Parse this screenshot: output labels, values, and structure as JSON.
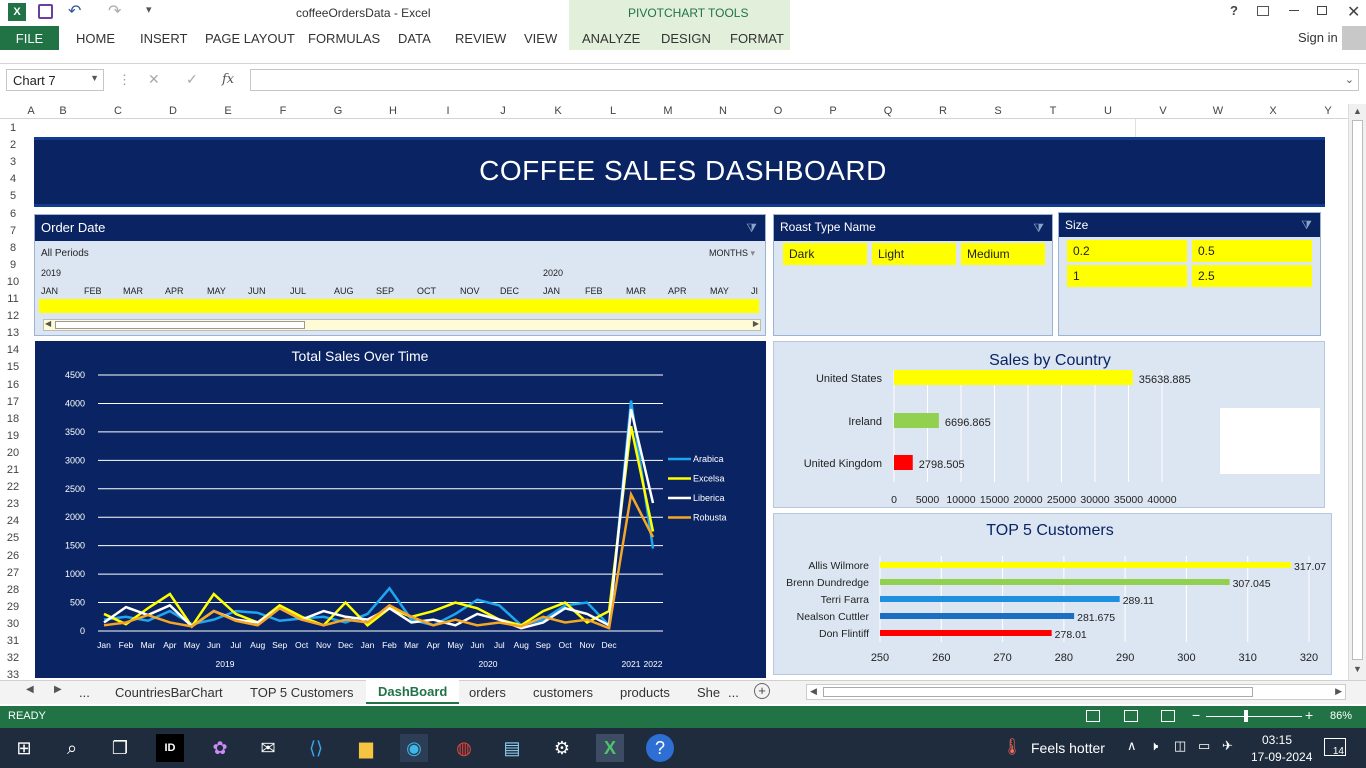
{
  "window": {
    "title": "coffeeOrdersData - Excel",
    "pivot_tools": "PIVOTCHART TOOLS",
    "help": "?",
    "signin": "Sign in"
  },
  "ribbon": {
    "file": "FILE",
    "tabs": [
      "HOME",
      "INSERT",
      "PAGE LAYOUT",
      "FORMULAS",
      "DATA",
      "REVIEW",
      "VIEW"
    ],
    "pivot_tabs": [
      "ANALYZE",
      "DESIGN",
      "FORMAT"
    ]
  },
  "formula_bar": {
    "name_box": "Chart 7",
    "fx": "fx",
    "value": ""
  },
  "columns": [
    "A",
    "B",
    "C",
    "D",
    "E",
    "F",
    "G",
    "H",
    "I",
    "J",
    "K",
    "L",
    "M",
    "N",
    "O",
    "P",
    "Q",
    "R",
    "S",
    "T",
    "U",
    "V",
    "W",
    "X",
    "Y"
  ],
  "rows": [
    "1",
    "2",
    "3",
    "4",
    "5",
    "6",
    "7",
    "8",
    "9",
    "10",
    "11",
    "12",
    "13",
    "14",
    "15",
    "16",
    "17",
    "18",
    "19",
    "20",
    "21",
    "22",
    "23",
    "24",
    "25",
    "26",
    "27",
    "28",
    "29",
    "30",
    "31",
    "32",
    "33"
  ],
  "dashboard": {
    "title": "COFFEE SALES DASHBOARD"
  },
  "timeline": {
    "title": "Order Date",
    "period": "All Periods",
    "unit": "MONTHS",
    "years": [
      "2019",
      "2020"
    ],
    "months": [
      "JAN",
      "FEB",
      "MAR",
      "APR",
      "MAY",
      "JUN",
      "JUL",
      "AUG",
      "SEP",
      "OCT",
      "NOV",
      "DEC",
      "JAN",
      "FEB",
      "MAR",
      "APR",
      "MAY",
      "JI"
    ]
  },
  "roast_slicer": {
    "title": "Roast Type Name",
    "items": [
      "Dark",
      "Light",
      "Medium"
    ]
  },
  "size_slicer": {
    "title": "Size",
    "items": [
      "0.2",
      "0.5",
      "1",
      "2.5"
    ]
  },
  "line_chart": {
    "title": "Total Sales Over Time",
    "y_ticks": [
      "4500",
      "4000",
      "3500",
      "3000",
      "2500",
      "2000",
      "1500",
      "1000",
      "500",
      "0"
    ],
    "months": [
      "Jan",
      "Feb",
      "Mar",
      "Apr",
      "May",
      "Jun",
      "Jul",
      "Aug",
      "Sep",
      "Oct",
      "Nov",
      "Dec",
      "Jan",
      "Feb",
      "Mar",
      "Apr",
      "May",
      "Jun",
      "Jul",
      "Aug",
      "Sep",
      "Oct",
      "Nov",
      "Dec"
    ],
    "years": [
      "2019",
      "2020",
      "2021",
      "2022"
    ],
    "legend": [
      "Arabica",
      "Excelsa",
      "Liberica",
      "Robusta"
    ],
    "colors": [
      "#1ea7f0",
      "#ffff00",
      "#ffffff",
      "#f5a623"
    ]
  },
  "country_chart": {
    "title": "Sales by Country",
    "countries": [
      "United States",
      "Ireland",
      "United Kingdom"
    ],
    "values": [
      "35638.885",
      "6696.865",
      "2798.505"
    ],
    "colors": [
      "#ffff00",
      "#92d050",
      "#ff0000"
    ],
    "x_ticks": [
      "0",
      "5000",
      "10000",
      "15000",
      "20000",
      "25000",
      "30000",
      "35000",
      "40000"
    ],
    "legend": [
      "United Kingdom",
      "Ireland",
      "United States"
    ]
  },
  "customers_chart": {
    "title": "TOP 5 Customers",
    "names": [
      "Allis Wilmore",
      "Brenn Dundredge",
      "Terri Farra",
      "Nealson Cuttler",
      "Don Flintiff"
    ],
    "values": [
      "317.07",
      "307.045",
      "289.11",
      "281.675",
      "278.01"
    ],
    "colors": [
      "#ffff00",
      "#92d050",
      "#1f8fe0",
      "#1a6fc0",
      "#ff0000"
    ],
    "x_ticks": [
      "250",
      "260",
      "270",
      "280",
      "290",
      "300",
      "310",
      "320"
    ]
  },
  "sheet_tabs": {
    "ellipsis": "...",
    "tabs": [
      "CountriesBarChart",
      "TOP 5 Customers",
      "DashBoard",
      "orders",
      "customers",
      "products",
      "She"
    ],
    "more": "..."
  },
  "status": {
    "ready": "READY",
    "zoom": "86%"
  },
  "taskbar": {
    "weather": "Feels hotter",
    "time": "03:15",
    "date": "17-09-2024",
    "notif": "14"
  },
  "chart_data": [
    {
      "type": "line",
      "title": "Total Sales Over Time",
      "ylim": [
        0,
        4500
      ],
      "x": [
        "Jan 2019",
        "Feb 2019",
        "Mar 2019",
        "Apr 2019",
        "May 2019",
        "Jun 2019",
        "Jul 2019",
        "Aug 2019",
        "Sep 2019",
        "Oct 2019",
        "Nov 2019",
        "Dec 2019",
        "Jan 2020",
        "Feb 2020",
        "Mar 2020",
        "Apr 2020",
        "May 2020",
        "Jun 2020",
        "Jul 2020",
        "Aug 2020",
        "Sep 2020",
        "Oct 2020",
        "Nov 2020",
        "Dec 2020",
        "2021",
        "2022"
      ],
      "series": [
        {
          "name": "Arabica",
          "values": [
            200,
            250,
            180,
            350,
            120,
            200,
            350,
            320,
            180,
            220,
            250,
            150,
            300,
            750,
            200,
            100,
            300,
            550,
            450,
            100,
            200,
            450,
            500,
            100,
            4050,
            1450
          ]
        },
        {
          "name": "Excelsa",
          "values": [
            300,
            120,
            400,
            650,
            80,
            650,
            300,
            150,
            450,
            250,
            100,
            500,
            100,
            400,
            250,
            350,
            500,
            400,
            200,
            100,
            350,
            500,
            150,
            350,
            3600,
            1750
          ]
        },
        {
          "name": "Liberica",
          "values": [
            150,
            420,
            280,
            450,
            80,
            350,
            200,
            150,
            400,
            200,
            350,
            250,
            200,
            400,
            150,
            200,
            100,
            300,
            200,
            50,
            150,
            400,
            300,
            100,
            3900,
            2250
          ]
        },
        {
          "name": "Robusta",
          "values": [
            100,
            150,
            280,
            150,
            80,
            350,
            180,
            100,
            400,
            200,
            100,
            200,
            150,
            450,
            250,
            100,
            200,
            100,
            150,
            80,
            250,
            150,
            200,
            50,
            2400,
            1650
          ]
        }
      ]
    },
    {
      "type": "bar",
      "title": "Sales by Country",
      "categories": [
        "United States",
        "Ireland",
        "United Kingdom"
      ],
      "values": [
        35638.885,
        6696.865,
        2798.505
      ],
      "xlim": [
        0,
        40000
      ]
    },
    {
      "type": "bar",
      "title": "TOP 5 Customers",
      "categories": [
        "Allis Wilmore",
        "Brenn Dundredge",
        "Terri Farra",
        "Nealson Cuttler",
        "Don Flintiff"
      ],
      "values": [
        317.07,
        307.045,
        289.11,
        281.675,
        278.01
      ],
      "xlim": [
        250,
        320
      ]
    }
  ]
}
